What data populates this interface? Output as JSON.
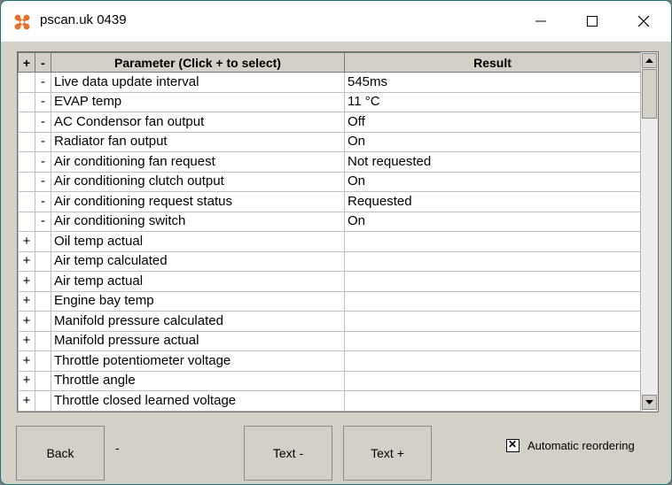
{
  "window": {
    "title": "pscan.uk 0439"
  },
  "table": {
    "headers": {
      "plus": "+",
      "minus": "-",
      "parameter": "Parameter (Click + to select)",
      "result": "Result"
    },
    "rows": [
      {
        "sign": "-",
        "parameter": "Live data update interval",
        "result": "545ms"
      },
      {
        "sign": "-",
        "parameter": "EVAP temp",
        "result": "11 °C"
      },
      {
        "sign": "-",
        "parameter": "AC Condensor fan output",
        "result": "Off"
      },
      {
        "sign": "-",
        "parameter": "Radiator fan output",
        "result": "On"
      },
      {
        "sign": "-",
        "parameter": "Air conditioning fan request",
        "result": "Not requested"
      },
      {
        "sign": "-",
        "parameter": "Air conditioning clutch output",
        "result": "On"
      },
      {
        "sign": "-",
        "parameter": "Air conditioning request status",
        "result": "Requested"
      },
      {
        "sign": "-",
        "parameter": "Air conditioning switch",
        "result": "On"
      },
      {
        "sign": "+",
        "parameter": "Oil temp actual",
        "result": ""
      },
      {
        "sign": "+",
        "parameter": "Air temp calculated",
        "result": ""
      },
      {
        "sign": "+",
        "parameter": "Air temp actual",
        "result": ""
      },
      {
        "sign": "+",
        "parameter": "Engine bay temp",
        "result": ""
      },
      {
        "sign": "+",
        "parameter": "Manifold pressure calculated",
        "result": ""
      },
      {
        "sign": "+",
        "parameter": "Manifold pressure actual",
        "result": ""
      },
      {
        "sign": "+",
        "parameter": "Throttle potentiometer voltage",
        "result": ""
      },
      {
        "sign": "+",
        "parameter": "Throttle angle",
        "result": ""
      },
      {
        "sign": "+",
        "parameter": "Throttle closed learned voltage",
        "result": ""
      }
    ]
  },
  "buttons": {
    "back": "Back",
    "text_minus": "Text -",
    "text_plus": "Text +"
  },
  "status_dash": "-",
  "auto_reorder": {
    "label": "Automatic reordering",
    "checked": true
  }
}
